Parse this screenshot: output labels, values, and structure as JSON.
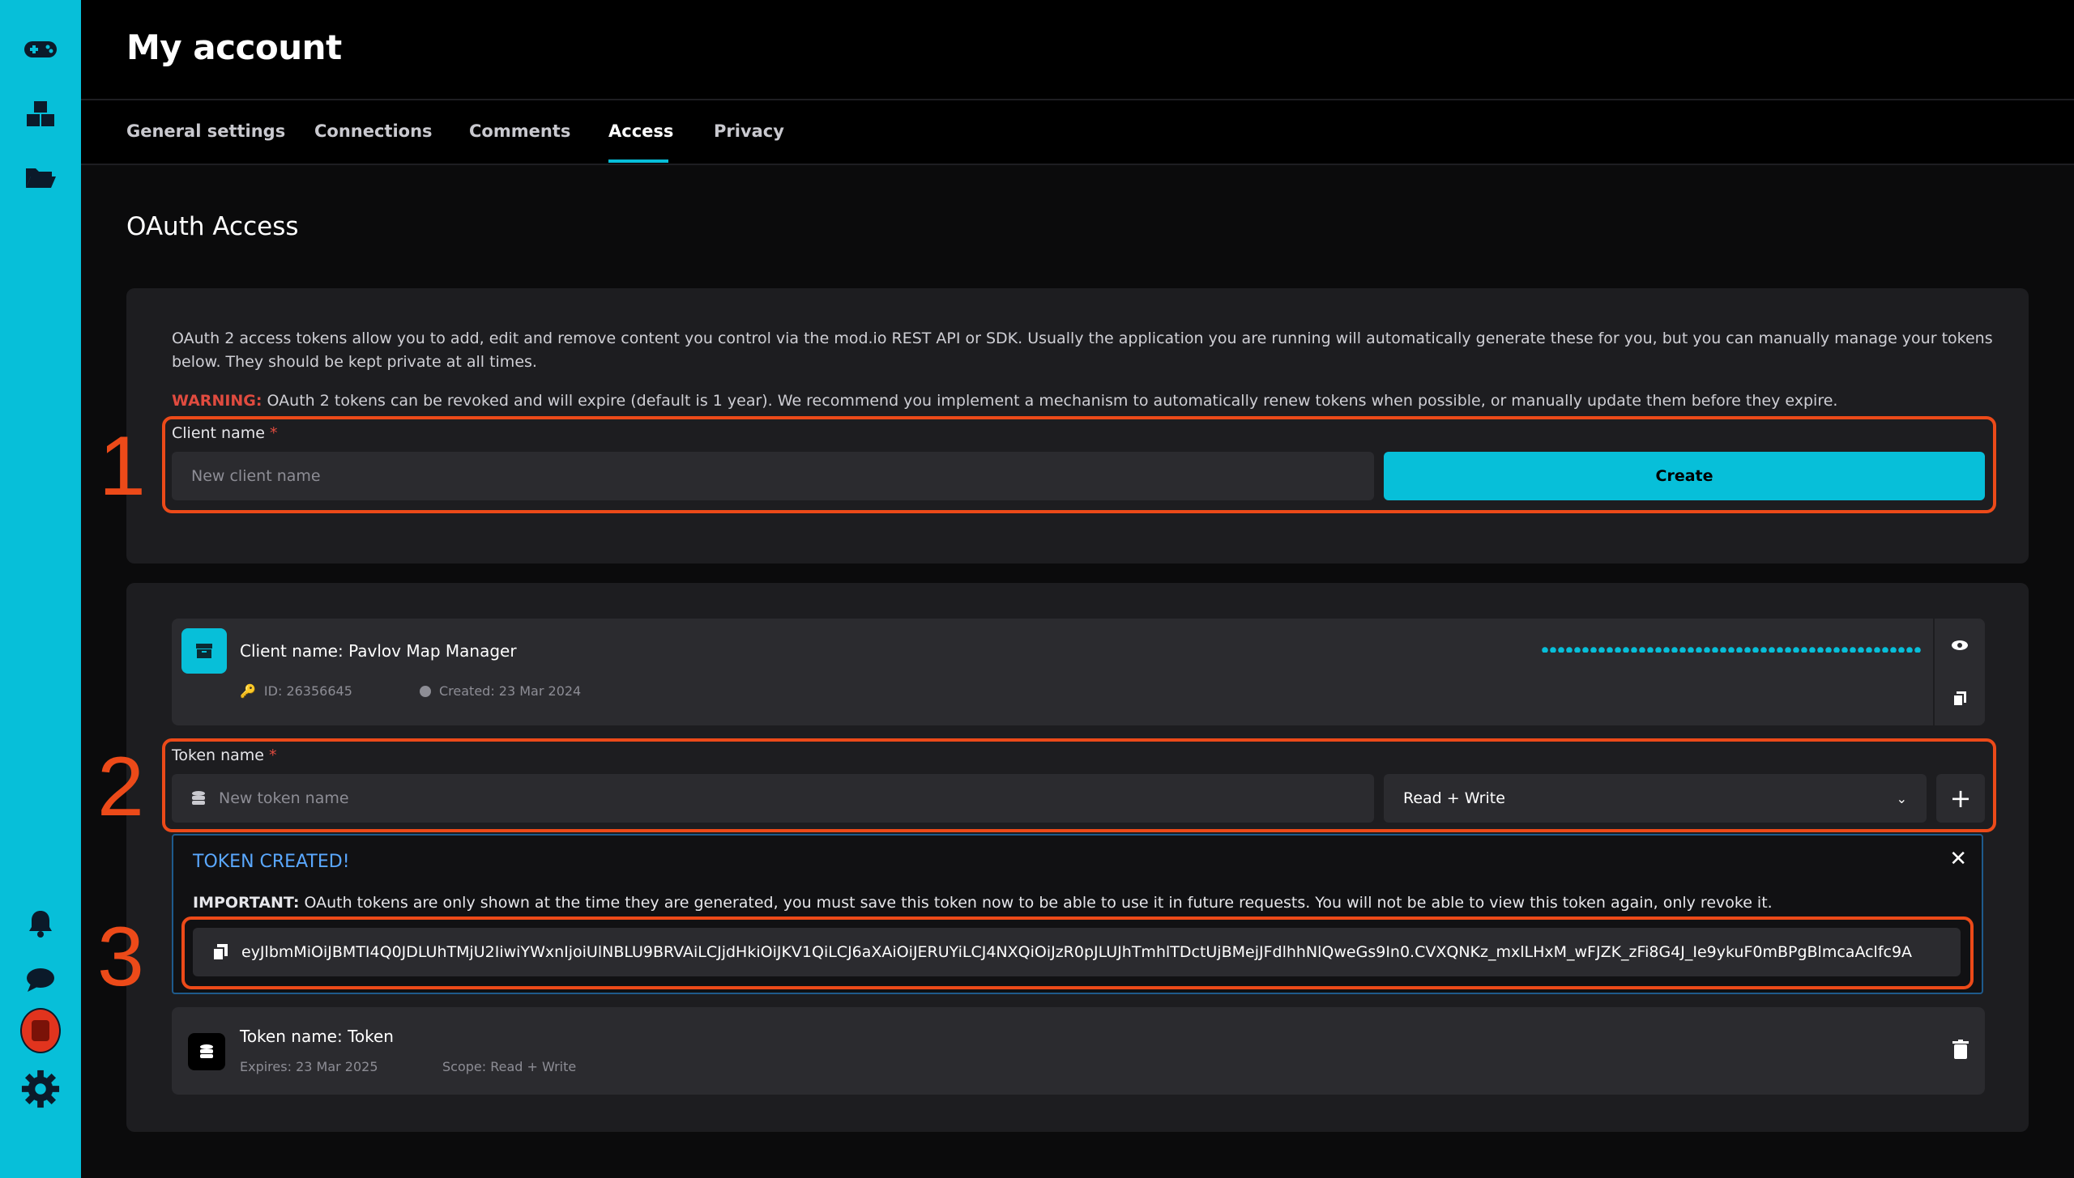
{
  "sidebar": {
    "icons": [
      "gamepad-icon",
      "cubes-icon",
      "folder-open-icon",
      "bell-icon",
      "chat-icon",
      "user-avatar",
      "cog-icon"
    ],
    "avatar_color": "#e1341e"
  },
  "header": {
    "title": "My account"
  },
  "tabs": [
    {
      "label": "General settings",
      "active": false
    },
    {
      "label": "Connections",
      "active": false
    },
    {
      "label": "Comments",
      "active": false
    },
    {
      "label": "Access",
      "active": true
    },
    {
      "label": "Privacy",
      "active": false
    }
  ],
  "oauth": {
    "section_title": "OAuth Access",
    "description": "OAuth 2 access tokens allow you to add, edit and remove content you control via the mod.io REST API or SDK. Usually the application you are running will automatically generate these for you, but you can manually manage your tokens below. They should be kept private at all times.",
    "warning_label": "WARNING:",
    "warning_text": " OAuth 2 tokens can be revoked and will expire (default is 1 year). We recommend you implement a mechanism to automatically renew tokens when possible, or manually update them before they expire.",
    "client_label": "Client name",
    "required_mark": "*",
    "client_placeholder": "New client name",
    "create_label": "Create"
  },
  "client": {
    "name": "Client name: Pavlov Map Manager",
    "id": "ID: 26356645",
    "created": "Created: 23 Mar 2024"
  },
  "token_form": {
    "label": "Token name",
    "required_mark": "*",
    "placeholder": "New token name",
    "scope_selected": "Read + Write",
    "add_label": "+"
  },
  "token_created": {
    "title": "TOKEN CREATED!",
    "important_label": "IMPORTANT:",
    "important_text": " OAuth tokens are only shown at the time they are generated, you must save this token now to be able to use it in future requests. You will not be able to view this token again, only revoke it.",
    "value": "eyJlbmMiOiJBMTI4Q0JDLUhTMjU2IiwiYWxnIjoiUlNBLU9BRVAiLCJjdHkiOiJKV1QiLCJ6aXAiOiJERUYiLCJ4NXQiOiJzR0pJLUJhTmhlTDctUjBMejJFdlhhNlQweGs9In0.CVXQNKz_mxlLHxM_wFJZK_zFi8G4J_Ie9ykuF0mBPgBlmcaAclfc9A"
  },
  "token": {
    "name": "Token name: Token",
    "expires": "Expires: 23 Mar 2025",
    "scope": "Scope: Read + Write"
  },
  "annotations": {
    "n1": "1",
    "n2": "2",
    "n3": "3"
  },
  "colors": {
    "accent": "#07bfd9",
    "annotation": "#ec4a19",
    "warning": "#e04b3f",
    "link": "#5aa8ff"
  }
}
